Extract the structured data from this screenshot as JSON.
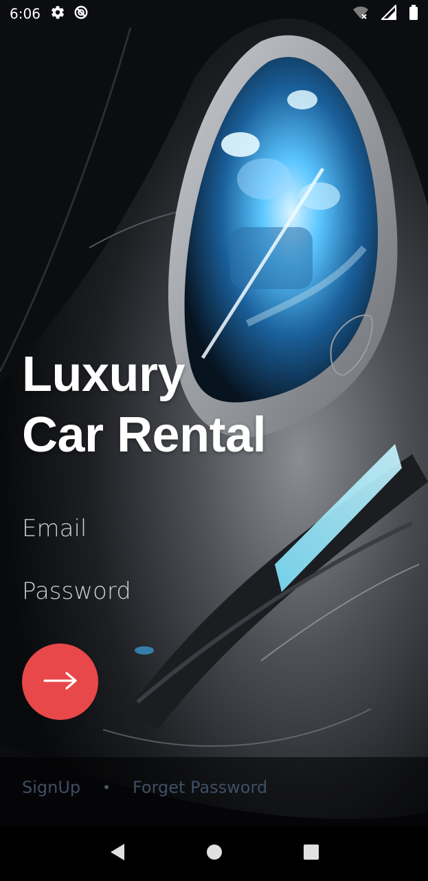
{
  "status_bar": {
    "time": "6:06",
    "left_icons": [
      "gear-icon",
      "circle-slash-icon"
    ],
    "right_icons": [
      "wifi-off-icon",
      "signal-icon",
      "battery-icon"
    ]
  },
  "hero": {
    "title_line1": "Luxury",
    "title_line2": "Car Rental"
  },
  "form": {
    "email_placeholder": "Email",
    "password_placeholder": "Password",
    "submit_icon": "arrow-right-icon",
    "submit_color": "#e8484a"
  },
  "links": {
    "signup": "SignUp",
    "separator": "•",
    "forget_password": "Forget Password"
  },
  "nav_bar": {
    "back_icon": "back-triangle-icon",
    "home_icon": "home-circle-icon",
    "recents_icon": "recents-square-icon"
  }
}
